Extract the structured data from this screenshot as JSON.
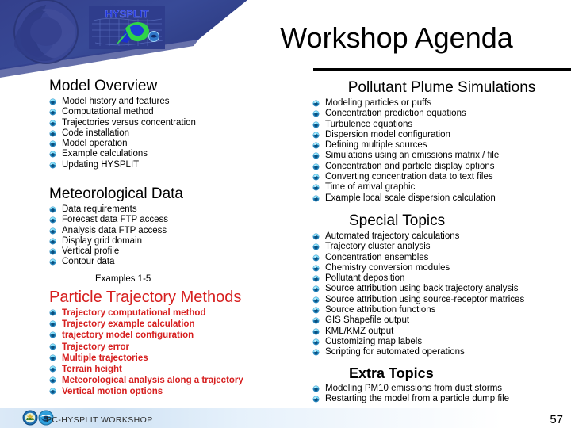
{
  "slide": {
    "title": "Workshop Agenda",
    "page_number": "57",
    "logo_text": "HYSPLIT",
    "footer_text": "PC-HYSPLIT WORKSHOP",
    "colors": {
      "banner_blue": "#32418d",
      "heading_black": "#000000",
      "heading_red": "#d61f1f",
      "bullet_cyan": "#29a8dd",
      "footer_band": "#cfe2f4"
    }
  },
  "left_column": {
    "sections": [
      {
        "heading": "Model Overview",
        "style": "black",
        "items": [
          "Model history and features",
          "Computational method",
          "Trajectories versus concentration",
          "Code installation",
          "Model operation",
          "Example calculations",
          "Updating HYSPLIT"
        ]
      },
      {
        "heading": "Meteorological Data",
        "style": "black",
        "items": [
          "Data requirements",
          "Forecast data FTP access",
          "Analysis data FTP access",
          "Display grid domain",
          "Vertical profile",
          "Contour data"
        ],
        "note": "Examples 1-5"
      },
      {
        "heading": "Particle Trajectory Methods",
        "style": "red",
        "items": [
          "Trajectory computational method",
          "Trajectory example calculation",
          "trajectory model configuration",
          "Trajectory error",
          "Multiple trajectories",
          "Terrain height",
          "Meteorological analysis along a trajectory",
          "Vertical motion options"
        ]
      }
    ]
  },
  "right_column": {
    "sections": [
      {
        "heading": "Pollutant Plume Simulations",
        "style": "black",
        "items": [
          "Modeling particles or puffs",
          "Concentration prediction equations",
          "Turbulence equations",
          "Dispersion model configuration",
          "Defining multiple sources",
          "Simulations using an emissions matrix / file",
          "Concentration and particle display options",
          "Converting concentration data to text files",
          "Time of arrival graphic",
          "Example local scale dispersion calculation"
        ]
      },
      {
        "heading": "Special Topics",
        "style": "black",
        "items": [
          "Automated trajectory calculations",
          "Trajectory cluster analysis",
          "Concentration ensembles",
          "Chemistry conversion modules",
          "Pollutant deposition",
          "Source attribution using back trajectory analysis",
          "Source attribution using source-receptor matrices",
          "Source attribution functions",
          "GIS Shapefile output",
          "KML/KMZ output",
          "Customizing map labels",
          "Scripting for automated operations"
        ]
      },
      {
        "heading": "Extra Topics",
        "style": "black",
        "items": [
          "Modeling PM10 emissions from dust storms",
          "Restarting the model from a particle dump file"
        ]
      }
    ]
  }
}
